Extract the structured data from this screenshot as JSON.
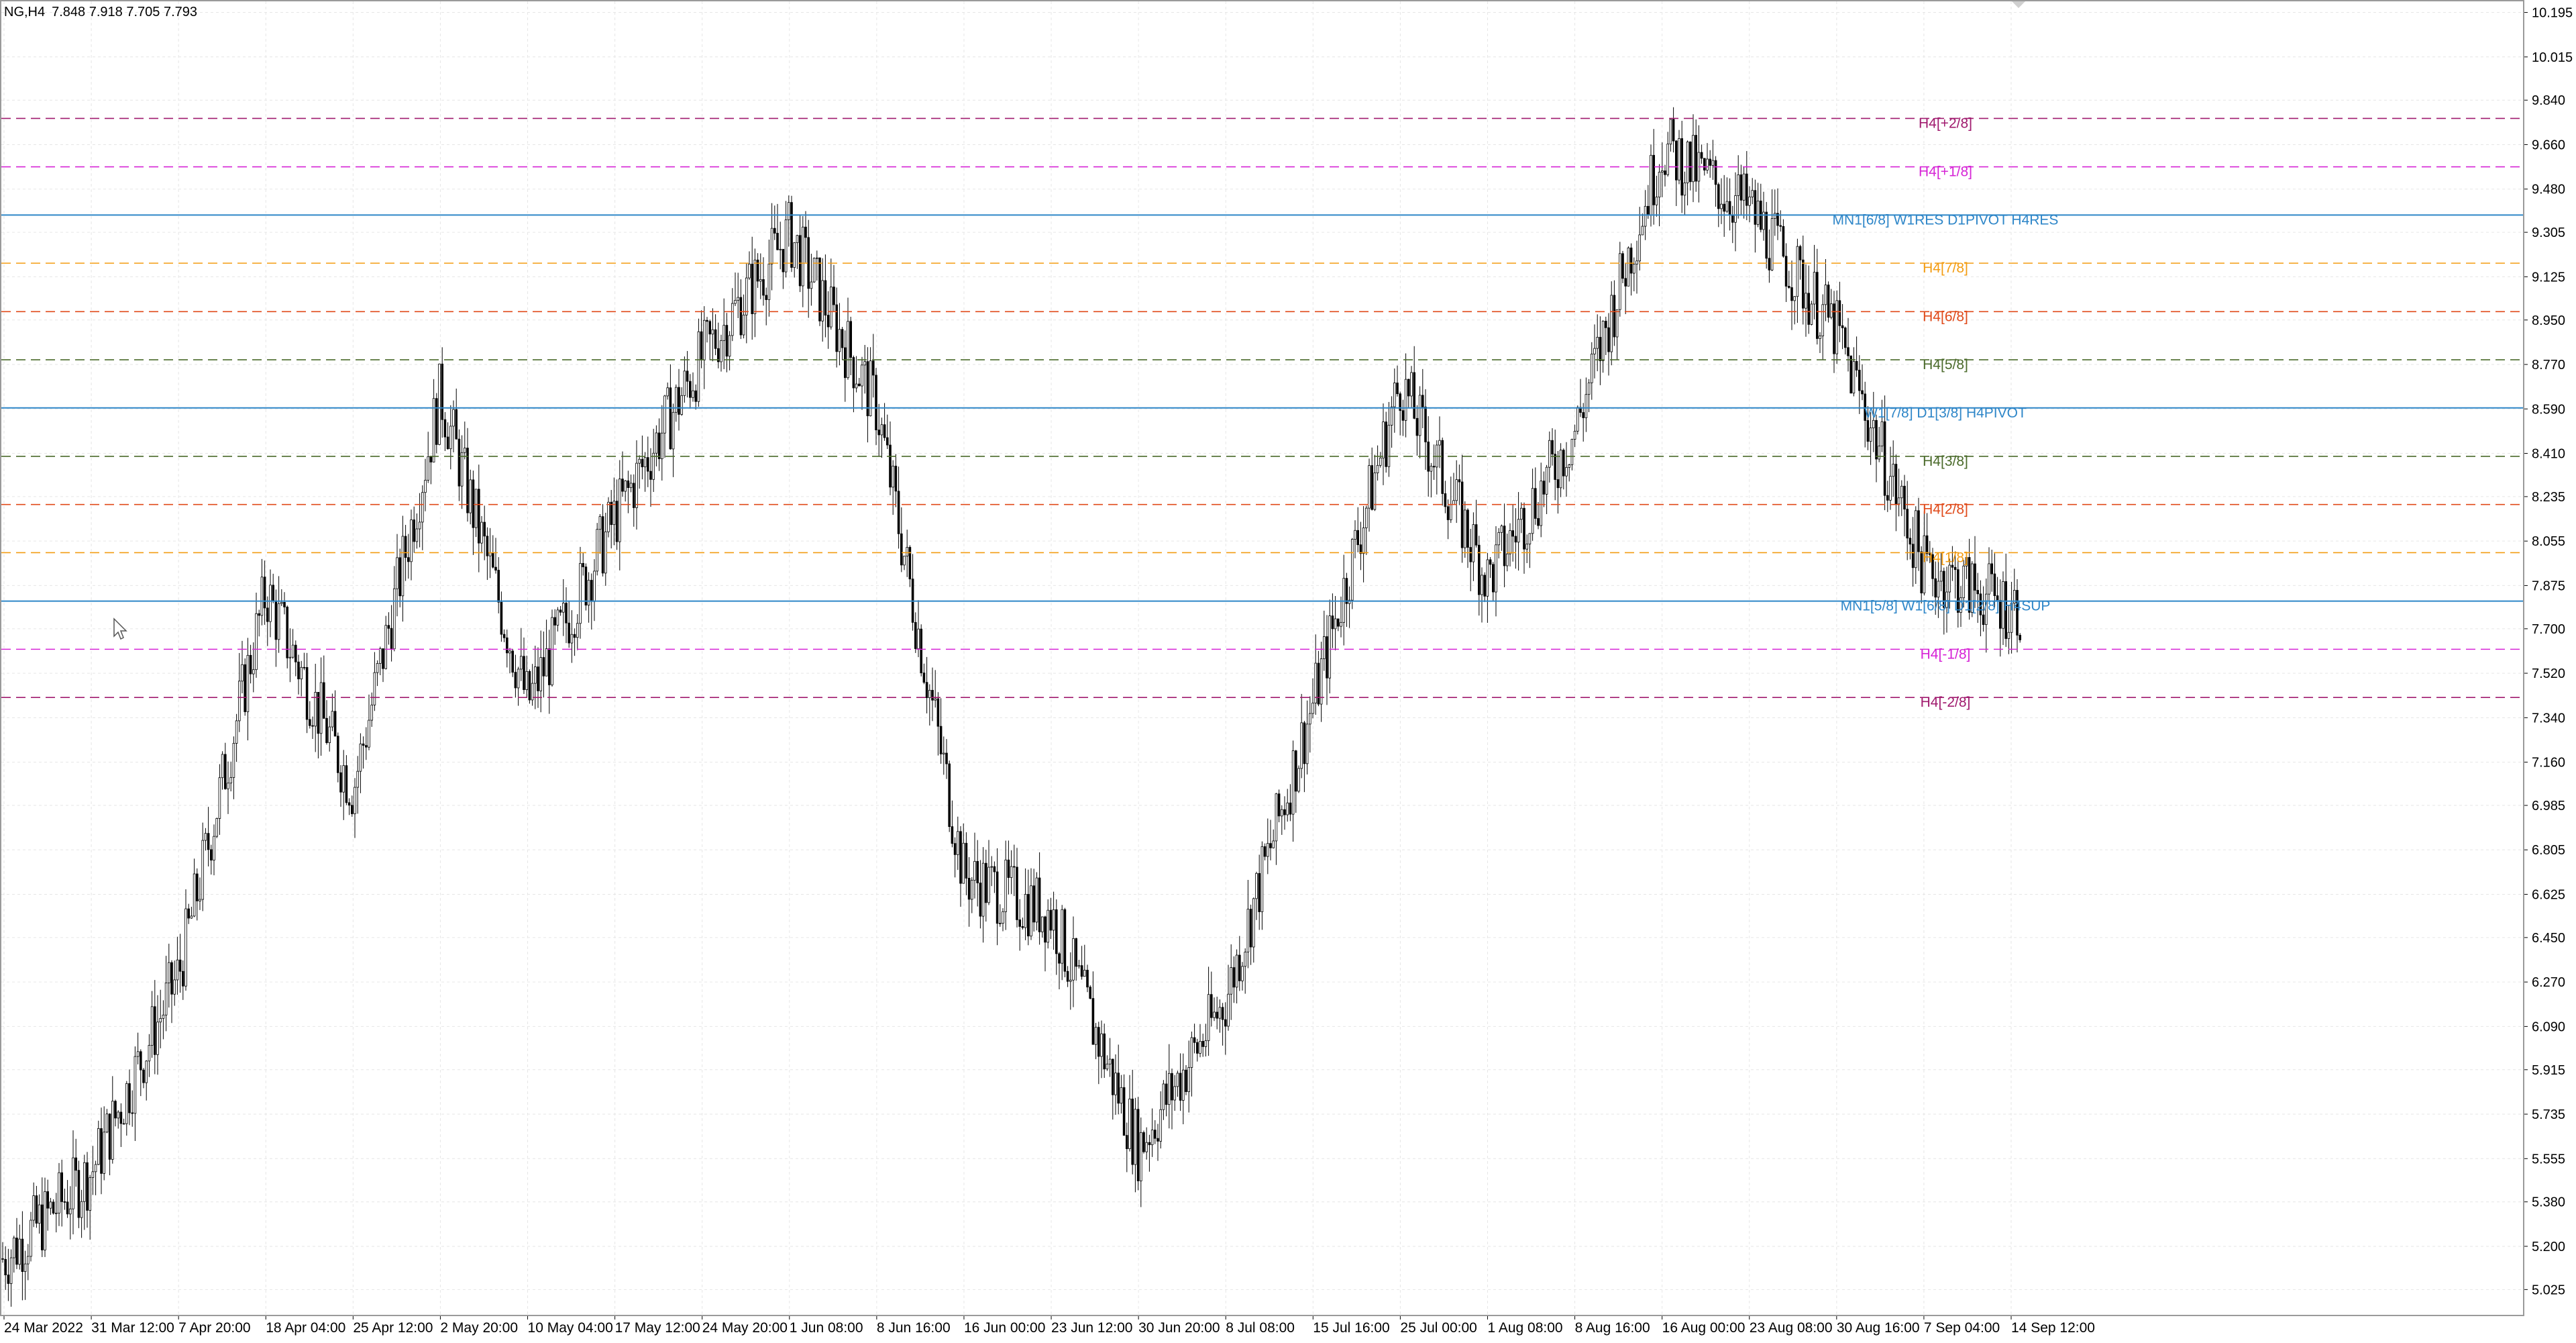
{
  "header": {
    "symbol": "NG,H4",
    "ohlc": "7.848 7.918 7.705 7.793"
  },
  "colors": {
    "background": "#ffffff",
    "grid": "#e6e6e6",
    "candle": "#000000",
    "frame": "#9a9a9a"
  },
  "chart_data": {
    "type": "candlestick",
    "title": "NG,H4",
    "xlabel": "",
    "ylabel": "",
    "ylim": [
      4.92,
      10.24
    ],
    "grid": true,
    "y_ticks": [
      "10.195",
      "10.015",
      "9.840",
      "9.660",
      "9.480",
      "9.305",
      "9.125",
      "8.950",
      "8.770",
      "8.590",
      "8.410",
      "8.235",
      "8.055",
      "7.875",
      "7.700",
      "7.520",
      "7.340",
      "7.160",
      "6.985",
      "6.805",
      "6.625",
      "6.450",
      "6.270",
      "6.090",
      "5.915",
      "5.735",
      "5.555",
      "5.380",
      "5.200",
      "5.025"
    ],
    "x_ticks": [
      "24 Mar 2022",
      "31 Mar 12:00",
      "7 Apr 20:00",
      "18 Apr 04:00",
      "25 Apr 12:00",
      "2 May 20:00",
      "10 May 04:00",
      "17 May 12:00",
      "24 May 20:00",
      "1 Jun 08:00",
      "8 Jun 16:00",
      "16 Jun 00:00",
      "23 Jun 12:00",
      "30 Jun 20:00",
      "8 Jul 08:00",
      "15 Jul 16:00",
      "25 Jul 00:00",
      "1 Aug 08:00",
      "8 Aug 16:00",
      "16 Aug 00:00",
      "23 Aug 08:00",
      "30 Aug 16:00",
      "7 Sep 04:00",
      "14 Sep 12:00"
    ],
    "series": [
      {
        "values": [
          {
            "time": "24 Mar 2022",
            "close": 5.15
          },
          {
            "time": "31 Mar 12:00",
            "close": 5.5
          },
          {
            "time": "7 Apr 20:00",
            "close": 6.3
          },
          {
            "time": "18 Apr 04:00",
            "close": 7.85
          },
          {
            "time": "25 Apr 12:00",
            "close": 7.05
          },
          {
            "time": "2 May 20:00",
            "close": 8.65
          },
          {
            "time": "10 May 04:00",
            "close": 7.4
          },
          {
            "time": "17 May 12:00",
            "close": 8.15
          },
          {
            "time": "24 May 20:00",
            "close": 8.8
          },
          {
            "time": "1 Jun 08:00",
            "close": 9.3
          },
          {
            "time": "8 Jun 16:00",
            "close": 8.6
          },
          {
            "time": "16 Jun 00:00",
            "close": 6.7
          },
          {
            "time": "23 Jun 12:00",
            "close": 6.55
          },
          {
            "time": "30 Jun 20:00",
            "close": 5.6
          },
          {
            "time": "8 Jul 08:00",
            "close": 6.2
          },
          {
            "time": "15 Jul 16:00",
            "close": 7.4
          },
          {
            "time": "25 Jul 00:00",
            "close": 8.7
          },
          {
            "time": "1 Aug 08:00",
            "close": 7.9
          },
          {
            "time": "8 Aug 16:00",
            "close": 8.5
          },
          {
            "time": "16 Aug 00:00",
            "close": 9.65
          },
          {
            "time": "23 Aug 08:00",
            "close": 9.4
          },
          {
            "time": "30 Aug 16:00",
            "close": 8.9
          },
          {
            "time": "7 Sep 04:00",
            "close": 7.95
          },
          {
            "time": "14 Sep 12:00",
            "close": 7.79
          }
        ]
      }
    ],
    "levels": [
      {
        "value": 9.766,
        "label": "H4[+2/8]",
        "tag": "9.766",
        "color": "#a01a6e",
        "style": "dashed"
      },
      {
        "value": 9.57,
        "label": "H4[+1/8]",
        "tag": "9.570",
        "color": "#d624d6",
        "style": "dashed"
      },
      {
        "value": 9.375,
        "label": "MN1[6/8] W1RES D1PIVOT H4RES",
        "tag": "9.375",
        "color": "#2e86c8",
        "style": "solid"
      },
      {
        "value": 9.18,
        "label": "H4[7/8]",
        "tag": "9.180",
        "color": "#f39c12",
        "style": "dashed"
      },
      {
        "value": 8.984,
        "label": "H4[6/8]",
        "tag": "8.984",
        "color": "#e04a1a",
        "style": "dashed"
      },
      {
        "value": 8.789,
        "label": "H4[5/8]",
        "tag": "8.789",
        "color": "#4a6a2a",
        "style": "dashed"
      },
      {
        "value": 8.594,
        "label": "W1[7/8] D1[3/8] H4PIVOT",
        "tag": "8.594",
        "color": "#2e86c8",
        "style": "solid"
      },
      {
        "value": 8.398,
        "label": "H4[3/8]",
        "tag": "8.398",
        "color": "#4a6a2a",
        "style": "dashed"
      },
      {
        "value": 8.203,
        "label": "H4[2/8]",
        "tag": "8.203",
        "color": "#e04a1a",
        "style": "dashed"
      },
      {
        "value": 8.008,
        "label": "H4[1/8]",
        "tag": "8.008",
        "color": "#f39c12",
        "style": "dashed"
      },
      {
        "value": 7.812,
        "label": "MN1[5/8] W1[6/8] D1[2/8] H4SUP",
        "tag": "7.812",
        "color": "#2e86c8",
        "style": "solid"
      },
      {
        "value": 7.617,
        "label": "H4[-1/8]",
        "tag": "7.617",
        "color": "#d624d6",
        "style": "dashed"
      },
      {
        "value": 7.422,
        "label": "H4[-2/8]",
        "tag": "7.422",
        "color": "#a01a6e",
        "style": "dashed"
      }
    ]
  }
}
